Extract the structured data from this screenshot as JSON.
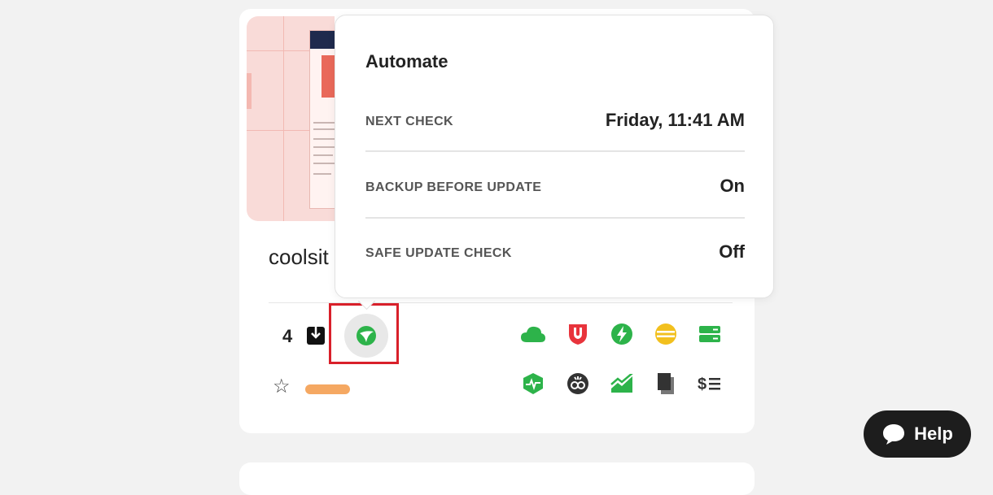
{
  "site": {
    "name": "coolsit",
    "updates_count": "4"
  },
  "popover": {
    "title": "Automate",
    "rows": [
      {
        "label": "NEXT CHECK",
        "value": "Friday, 11:41 AM"
      },
      {
        "label": "BACKUP BEFORE UPDATE",
        "value": "On"
      },
      {
        "label": "SAFE UPDATE CHECK",
        "value": "Off"
      }
    ]
  },
  "service_icons": {
    "row1": [
      "cloud-icon",
      "shield-badge-icon",
      "lightning-icon",
      "database-icon",
      "server-icon"
    ],
    "row2": [
      "uptime-shield-icon",
      "analytics-icon",
      "chart-icon",
      "copy-icon",
      "billing-icon"
    ]
  },
  "help": {
    "label": "Help"
  },
  "colors": {
    "green": "#2db34a",
    "red": "#e8343c",
    "yellow": "#f2c01e",
    "highlight": "#d9202a",
    "tag": "#f5a862"
  }
}
